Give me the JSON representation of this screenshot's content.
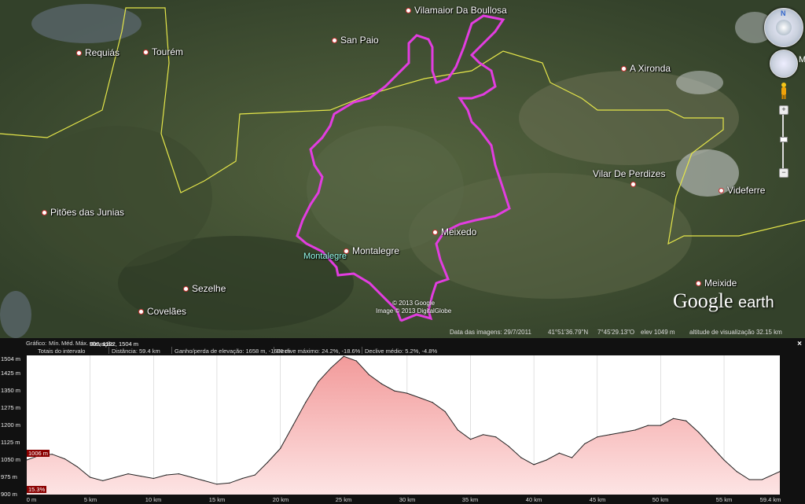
{
  "map": {
    "places": [
      {
        "name": "Vilamaior Da Boullosa",
        "dot": true
      },
      {
        "name": "San Paio",
        "dot": true
      },
      {
        "name": "Requiás",
        "dot": true
      },
      {
        "name": "Tourém",
        "dot": true
      },
      {
        "name": "A Xironda",
        "dot": true
      },
      {
        "name": "Vilar De Perdizes",
        "dot": true
      },
      {
        "name": "Videferre",
        "dot": true
      },
      {
        "name": "Pitões das Junias",
        "dot": true
      },
      {
        "name": "Meixedo",
        "dot": true
      },
      {
        "name": "Montalegre",
        "dot": true
      },
      {
        "name": "Montalegre",
        "dot": false
      },
      {
        "name": "Sezelhe",
        "dot": true
      },
      {
        "name": "Covelães",
        "dot": true
      },
      {
        "name": "Meixide",
        "dot": true
      }
    ],
    "credits": [
      "© 2013 Google",
      "Image © 2013 DigitalGlobe"
    ],
    "logo": {
      "google": "Google",
      "earth": "earth"
    },
    "nav_letter": "N",
    "edge_letter": "M",
    "colors": {
      "track": "#e23de0",
      "border": "#e5e64a"
    }
  },
  "statusbar": {
    "imagery_date": "Data das imagens: 29/7/2011",
    "lat": "41°51'36.79\"N",
    "lon": "7°45'29.13\"O",
    "elev": "elev  1049 m",
    "eye_alt": "altitude de visualização  32.15 km"
  },
  "profile": {
    "row1": {
      "graph": "Gráfico:",
      "min": "Mín.",
      "avg": "Méd.",
      "max": "Máx.",
      "elevation": "Elevação:",
      "elevation_values": "900, 1122, 1504 m"
    },
    "row2": {
      "totals": "Totais do intervalo",
      "distance": "Distância: 59.4 km",
      "gain_loss": "Ganho/perda de elevação: 1658 m, -1681 m",
      "max_slope": "Declive máximo: 24.2%, -18.6%",
      "avg_slope": "Declive médio: 5.2%, -4.8%"
    },
    "close_label": "×",
    "cursor_elev_label": "1006 m",
    "cursor_pct_label": "15.3%",
    "y_ticks": [
      "1504 m",
      "1425 m",
      "1350 m",
      "1275 m",
      "1200 m",
      "1125 m",
      "1050 m",
      "975 m",
      "900 m"
    ],
    "x_ticks": [
      "0 m",
      "5 km",
      "10 km",
      "15 km",
      "20 km",
      "25 km",
      "30 km",
      "35 km",
      "40 km",
      "45 km",
      "50 km",
      "55 km",
      "59.4 km"
    ]
  },
  "chart_data": {
    "type": "area",
    "title": "",
    "xlabel": "",
    "ylabel": "",
    "xlim": [
      0,
      59.4
    ],
    "ylim": [
      900,
      1504
    ],
    "x": [
      0,
      1,
      2,
      3,
      4,
      5,
      6,
      7,
      8,
      9,
      10,
      11,
      12,
      13,
      14,
      15,
      16,
      17,
      18,
      19,
      20,
      21,
      22,
      23,
      24,
      25,
      26,
      27,
      28,
      29,
      30,
      31,
      32,
      33,
      34,
      35,
      36,
      37,
      38,
      39,
      40,
      41,
      42,
      43,
      44,
      45,
      46,
      47,
      48,
      49,
      50,
      51,
      52,
      53,
      54,
      55,
      56,
      57,
      58,
      59.4
    ],
    "series": [
      {
        "values": [
          1050,
          1070,
          1075,
          1055,
          1020,
          975,
          960,
          975,
          990,
          980,
          970,
          985,
          990,
          975,
          960,
          945,
          950,
          970,
          985,
          1040,
          1100,
          1200,
          1300,
          1390,
          1450,
          1500,
          1480,
          1420,
          1380,
          1350,
          1340,
          1320,
          1300,
          1260,
          1180,
          1140,
          1160,
          1150,
          1110,
          1060,
          1030,
          1050,
          1080,
          1060,
          1120,
          1150,
          1160,
          1170,
          1180,
          1200,
          1200,
          1230,
          1220,
          1170,
          1110,
          1050,
          1000,
          965,
          965,
          1000
        ]
      }
    ],
    "grid": true
  }
}
